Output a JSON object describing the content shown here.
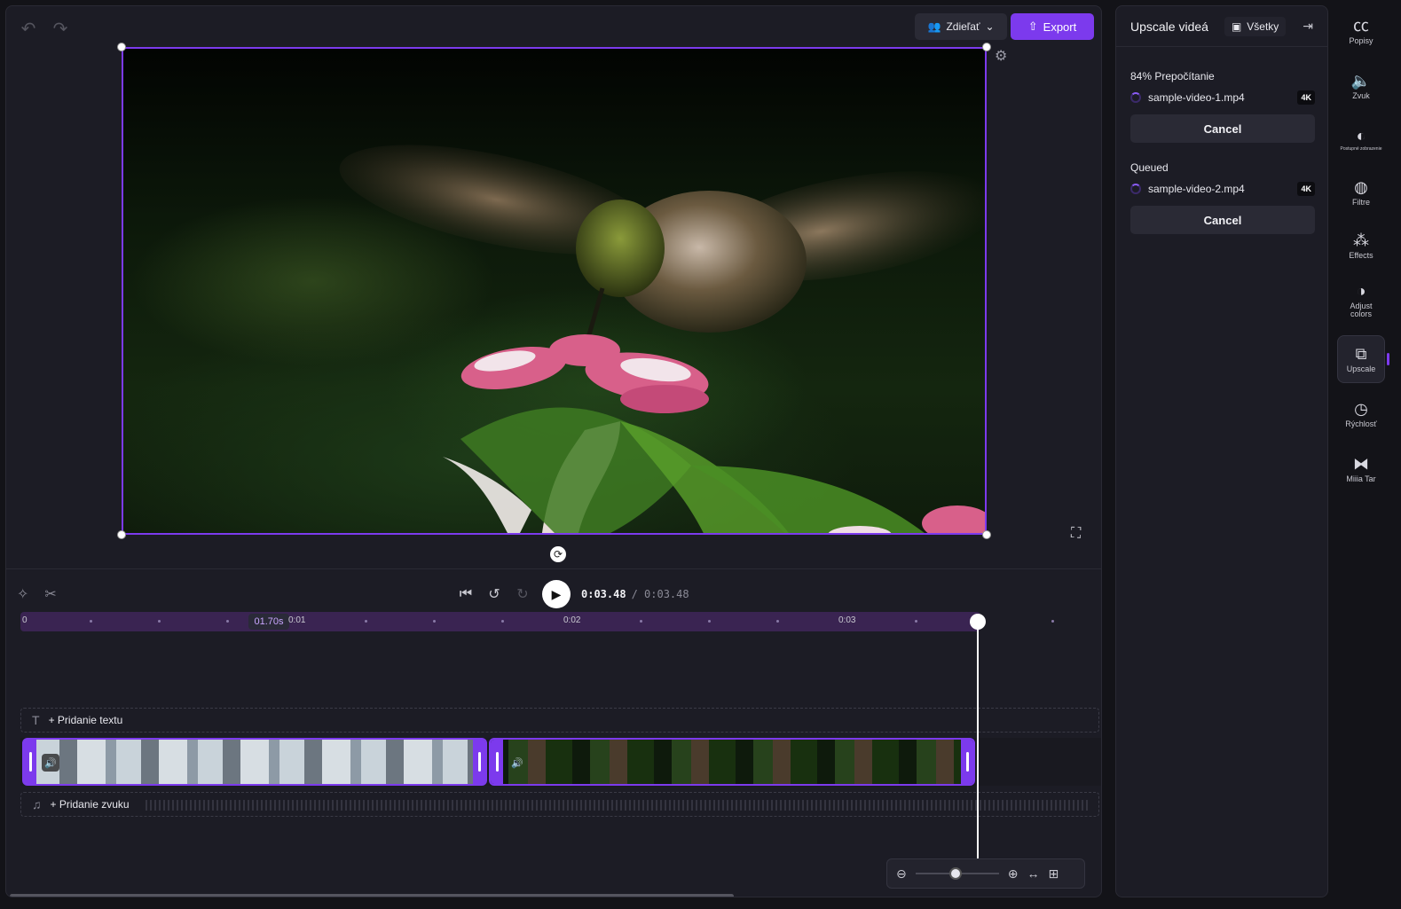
{
  "toolbar": {
    "share_label": "Zdieľať",
    "export_label": "Export"
  },
  "transport": {
    "current_time": "0:03.48",
    "total_time": "/ 0:03.48",
    "skip_back_label": "5",
    "skip_fwd_label": "5"
  },
  "ruler": {
    "labels": [
      "0",
      "0:01",
      "0:02",
      "0:03"
    ],
    "marker": "01.70s"
  },
  "tracks": {
    "add_text": "Pridanie textu",
    "add_audio": "Pridanie zvuku"
  },
  "panel": {
    "title": "Upscale videá",
    "filter_label": "Všetky",
    "processing": {
      "label": "84% Prepočítanie",
      "file": "sample-video-1.mp4",
      "badge": "4K",
      "cancel": "Cancel"
    },
    "queued": {
      "label": "Queued",
      "file": "sample-video-2.mp4",
      "badge": "4K",
      "cancel": "Cancel"
    }
  },
  "rail": {
    "captions": "Popisy",
    "audio": "Zvuk",
    "fade": "Postupné zobrazenie",
    "filters": "Filtre",
    "effects": "Effects",
    "adjust_colors": "Adjust colors",
    "upscale": "Upscale",
    "speed": "Rýchlosť",
    "transition": "Miiia Tar"
  },
  "colors": {
    "accent": "#7c3aed",
    "panel_bg": "#1c1c25",
    "app_bg": "#131318"
  },
  "icons": [
    "undo-icon",
    "redo-icon",
    "share-icon",
    "upload-icon",
    "settings-icon",
    "fullscreen-icon",
    "rotate-icon",
    "magic-icon",
    "scissors-icon",
    "skip-start-icon",
    "rewind-5-icon",
    "forward-5-icon",
    "play-icon",
    "volume-icon",
    "text-icon",
    "music-icon",
    "zoom-out-icon",
    "zoom-in-icon",
    "fit-icon",
    "expand-icon",
    "captions-icon",
    "audio-icon",
    "fade-icon",
    "filters-icon",
    "effects-icon",
    "adjust-colors-icon",
    "upscale-icon",
    "speed-icon",
    "transition-icon",
    "play-square-icon",
    "dock-icon"
  ]
}
